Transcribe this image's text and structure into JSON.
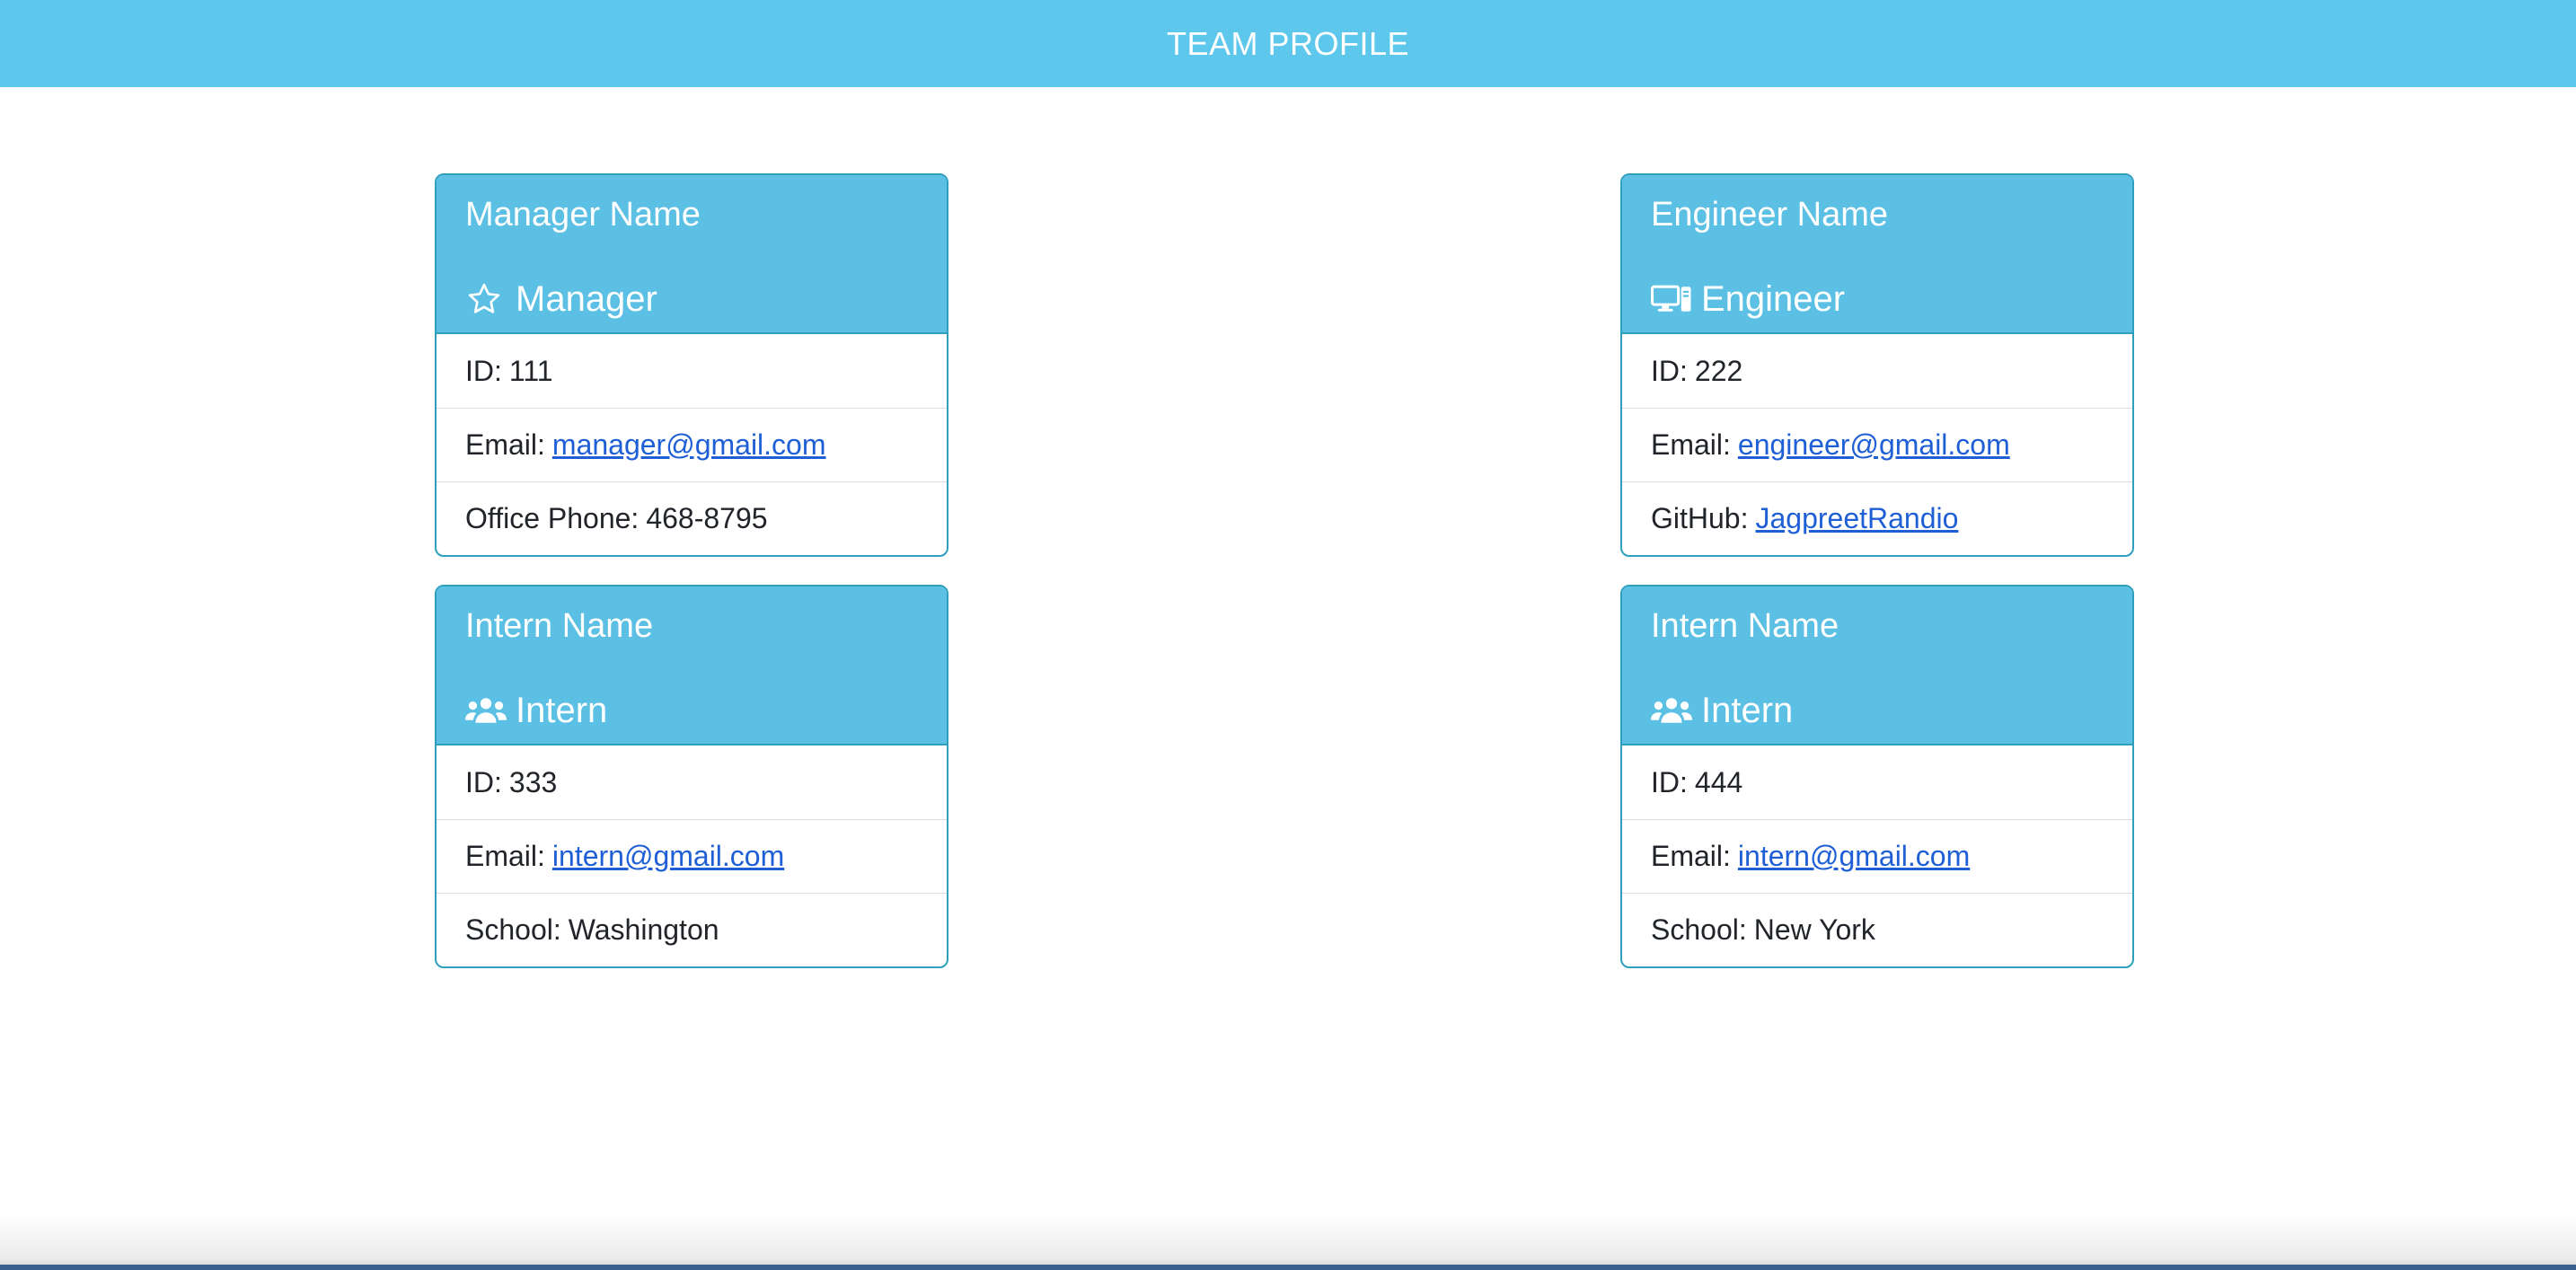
{
  "header": {
    "title": "TEAM PROFILE"
  },
  "colors": {
    "header_bg": "#5ec8ec",
    "card_head_bg": "#5bc0e4",
    "card_border": "#2f9fbe",
    "link": "#1f5fd6"
  },
  "cards": [
    {
      "name": "Manager Name",
      "role": "Manager",
      "role_icon": "star-icon",
      "id_label": "ID:",
      "id_value": "111",
      "email_label": "Email:",
      "email_value": "manager@gmail.com",
      "extra_label": "Office Phone:",
      "extra_value": "468-8795"
    },
    {
      "name": "Engineer Name",
      "role": "Engineer",
      "role_icon": "computer-icon",
      "id_label": "ID:",
      "id_value": "222",
      "email_label": "Email:",
      "email_value": "engineer@gmail.com",
      "extra_label": "GitHub:",
      "extra_value": "JagpreetRandio"
    },
    {
      "name": "Intern Name",
      "role": "Intern",
      "role_icon": "users-icon",
      "id_label": "ID:",
      "id_value": "333",
      "email_label": "Email:",
      "email_value": "intern@gmail.com",
      "extra_label": "School:",
      "extra_value": "Washington"
    },
    {
      "name": "Intern Name",
      "role": "Intern",
      "role_icon": "users-icon",
      "id_label": "ID:",
      "id_value": "444",
      "email_label": "Email:",
      "email_value": "intern@gmail.com",
      "extra_label": "School:",
      "extra_value": "New York"
    }
  ]
}
